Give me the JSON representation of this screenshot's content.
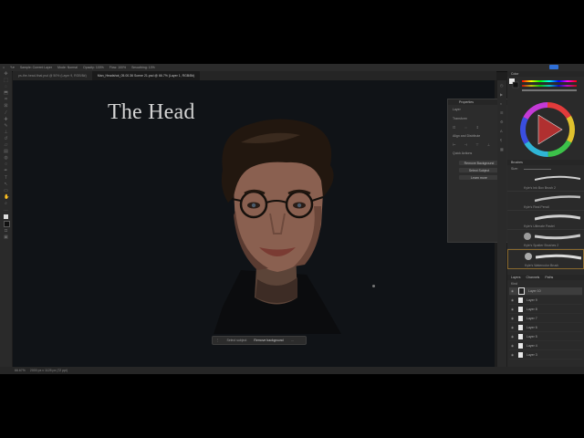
{
  "options_bar": {
    "items": [
      "Sample: Current Layer",
      "Mode: Normal",
      "Opacity: 100%",
      "Flow: 100%",
      "Smoothing: 10%"
    ]
  },
  "tabs": [
    {
      "label": "ps-the-head-final.psd @ 50% (Layer 9, RGB/8#)",
      "active": false
    },
    {
      "label": "Man_Headshot_05.00.36 Scene 21.psd @ 66.7% (Layer 1, RGB/8#)",
      "active": true
    }
  ],
  "canvas": {
    "title": "The Head"
  },
  "context_bar": {
    "items": [
      "Select subject",
      "Remove background",
      "…"
    ]
  },
  "properties_panel": {
    "title": "Properties",
    "sections": [
      "Layer",
      "Transform",
      "Align and Distribute",
      "Quick Actions"
    ],
    "buttons": [
      "Remove Background",
      "Select Subject",
      "Learn more"
    ]
  },
  "color_panel": {
    "title": "Color"
  },
  "brushes_panel": {
    "title": "Brushes",
    "size_label": "Size:",
    "brushes": [
      "Kyle's Ink Box Brush 2",
      "Kyle's Real Pencil",
      "Kyle's Ultimate Pastel",
      "Kyle's Spatter Brushes 2",
      "Kyle's Watercolor Brush"
    ]
  },
  "layers_panel": {
    "tabs": [
      "Layers",
      "Channels",
      "Paths"
    ],
    "kind_label": "Kind",
    "layers": [
      {
        "name": "Layer 10",
        "selected": true
      },
      {
        "name": "Layer 9",
        "selected": false
      },
      {
        "name": "Layer 8",
        "selected": false
      },
      {
        "name": "Layer 7",
        "selected": false
      },
      {
        "name": "Layer 6",
        "selected": false
      },
      {
        "name": "Layer 5",
        "selected": false
      },
      {
        "name": "Layer 4",
        "selected": false
      },
      {
        "name": "Layer 3",
        "selected": false
      }
    ]
  },
  "status_bar": {
    "zoom": "66.67%",
    "doc_info": "2000 px x 1125 px (72 ppi)"
  },
  "colors": {
    "app_bg": "#1e1e1e",
    "panel_bg": "#2a2a2a",
    "doc_bg": "#101317",
    "accent": "#2f6fd6",
    "title_text": "#d4d4d4"
  }
}
